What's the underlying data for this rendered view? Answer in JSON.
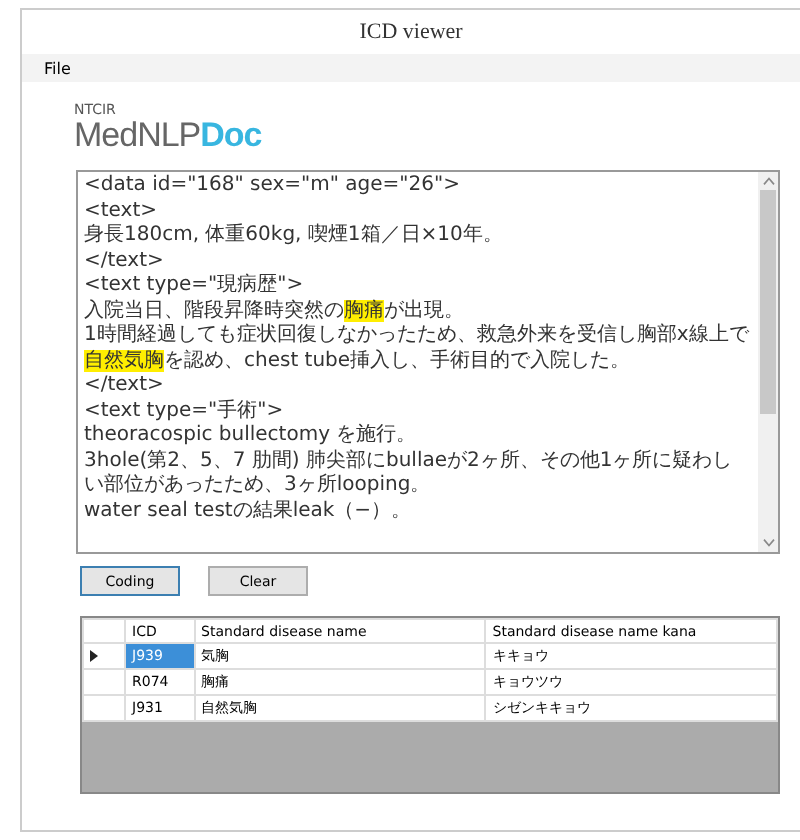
{
  "window": {
    "title": "ICD viewer"
  },
  "menu": [
    "File"
  ],
  "logo": {
    "small": "NTCIR",
    "main": "MedNLP",
    "accent": "Doc"
  },
  "document": {
    "lines": [
      [
        {
          "text": "<data id=\"168\" sex=\"m\" age=\"26\">",
          "highlighted": false
        }
      ],
      [
        {
          "text": "<text>",
          "highlighted": false
        }
      ],
      [
        {
          "text": "身長180cm, 体重60kg, 喫煙1箱／日×10年。",
          "highlighted": false
        }
      ],
      [
        {
          "text": "</text>",
          "highlighted": false
        }
      ],
      [
        {
          "text": "<text type=\"現病歴\">",
          "highlighted": false
        }
      ],
      [
        {
          "text": "入院当日、階段昇降時突然の",
          "highlighted": false
        },
        {
          "text": "胸痛",
          "highlighted": true
        },
        {
          "text": "が出現。",
          "highlighted": false
        }
      ],
      [
        {
          "text": "1時間経過しても症状回復しなかったため、救急外来を受信し胸部x線上で",
          "highlighted": false
        },
        {
          "text": "自然気胸",
          "highlighted": true
        },
        {
          "text": "を認め、chest tube挿入し、手術目的で入院した。",
          "highlighted": false
        }
      ],
      [
        {
          "text": "</text>",
          "highlighted": false
        }
      ],
      [
        {
          "text": "<text type=\"手術\">",
          "highlighted": false
        }
      ],
      [
        {
          "text": "theoracospic bullectomy を施行。",
          "highlighted": false
        }
      ],
      [
        {
          "text": "3hole(第2、5、7 肋間) 肺尖部にbullaeが2ヶ所、その他1ヶ所に疑わしい部位があったため、3ヶ所looping。",
          "highlighted": false
        }
      ],
      [
        {
          "text": "water seal testの結果leak（−）。",
          "highlighted": false
        }
      ]
    ]
  },
  "buttons": [
    "Coding",
    "Clear"
  ],
  "table": {
    "columns": [
      "ICD",
      "Standard disease name",
      "Standard disease name kana"
    ],
    "rows": [
      {
        "selected": true,
        "cells": [
          "J939",
          "気胸",
          "キキョウ"
        ]
      },
      {
        "selected": false,
        "cells": [
          "R074",
          "胸痛",
          "キョウツウ"
        ]
      },
      {
        "selected": false,
        "cells": [
          "J931",
          "自然気胸",
          "シゼンキキョウ"
        ]
      }
    ]
  }
}
